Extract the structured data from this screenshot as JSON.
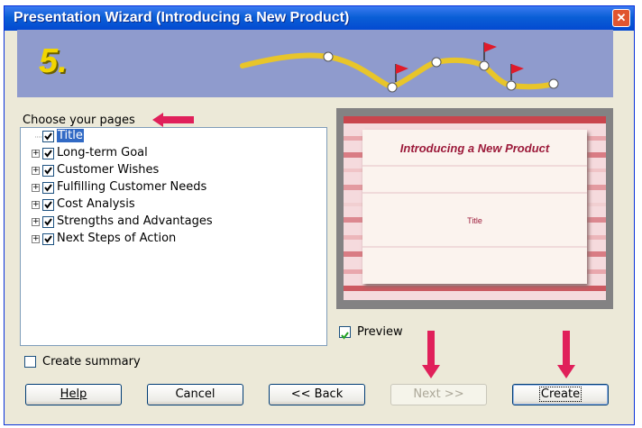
{
  "window": {
    "title": "Presentation Wizard (Introducing a New Product)",
    "close_glyph": "✕"
  },
  "banner": {
    "step": "5."
  },
  "pages": {
    "label": "Choose your pages",
    "items": [
      {
        "label": "Title",
        "checked": true,
        "expandable": false,
        "selected": true
      },
      {
        "label": "Long-term Goal",
        "checked": true,
        "expandable": true,
        "selected": false
      },
      {
        "label": "Customer Wishes",
        "checked": true,
        "expandable": true,
        "selected": false
      },
      {
        "label": "Fulfilling Customer Needs",
        "checked": true,
        "expandable": true,
        "selected": false
      },
      {
        "label": "Cost Analysis",
        "checked": true,
        "expandable": true,
        "selected": false
      },
      {
        "label": "Strengths and Advantages",
        "checked": true,
        "expandable": true,
        "selected": false
      },
      {
        "label": "Next Steps of Action",
        "checked": true,
        "expandable": true,
        "selected": false
      }
    ]
  },
  "preview": {
    "slide_title": "Introducing a New Product",
    "slide_subtitle": "Title",
    "checkbox_label": "Preview",
    "checked": true
  },
  "summary": {
    "checkbox_label": "Create summary",
    "checked": false
  },
  "buttons": {
    "help": "Help",
    "cancel": "Cancel",
    "back": "<< Back",
    "next": "Next >>",
    "create": "Create"
  },
  "colors": {
    "titlebar": "#0a5fd6",
    "banner": "#8f9bcd",
    "arrow": "#e0205a",
    "selection": "#316ac5"
  },
  "icons": {
    "expander": "plus-box-icon",
    "check": "checkmark-icon",
    "arrow": "red-arrow-icon",
    "flag": "red-flag-icon"
  }
}
